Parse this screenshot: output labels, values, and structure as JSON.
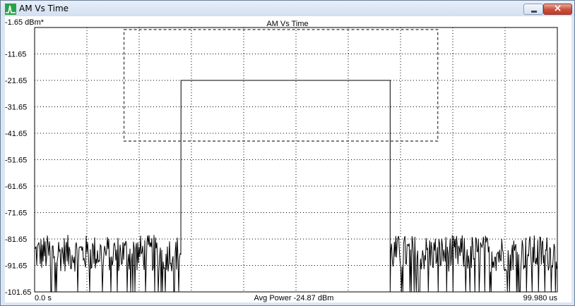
{
  "window": {
    "title": "AM Vs Time",
    "minimize_icon": "minimize-icon",
    "close_icon": "close-icon",
    "app_icon": "spectrum-icon"
  },
  "chart_data": {
    "type": "line",
    "title": "AM Vs Time",
    "ylabel": "",
    "xlabel": "",
    "ylim": [
      -101.65,
      -1.65
    ],
    "xlim": [
      0,
      99.98
    ],
    "y_ticks": [
      "-1.65 dBm*",
      "-11.65",
      "-21.65",
      "-31.65",
      "-41.65",
      "-51.65",
      "-61.65",
      "-71.65",
      "-81.65",
      "-91.65",
      "-101.65"
    ],
    "x_start_label": "0.0 s",
    "x_end_label": "99.980 us",
    "footer": "Avg Power -24.87 dBm",
    "grid": true,
    "series": [
      {
        "color": "#000000",
        "segments": [
          {
            "x_start": 0,
            "x_end": 28,
            "noise_floor_min": -101.65,
            "noise_floor_max": -80
          },
          {
            "x_start": 28,
            "x_end": 68,
            "level": -21.65
          },
          {
            "x_start": 68,
            "x_end": 99.98,
            "noise_floor_min": -101.65,
            "noise_floor_max": -80
          }
        ]
      }
    ],
    "mask": {
      "style": "dashed",
      "color": "#555555",
      "x_range": [
        17.1,
        77.1
      ],
      "y_range": [
        -44.6,
        -2.4
      ]
    }
  }
}
